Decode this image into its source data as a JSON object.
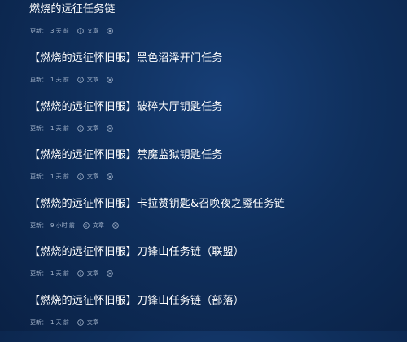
{
  "articles": [
    {
      "title": "燃烧的远征任务链",
      "updated_label": "更新：",
      "time": "3 天 前",
      "type": "文章"
    },
    {
      "title": "【燃烧的远征怀旧服】黑色沼泽开门任务",
      "updated_label": "更新：",
      "time": "1 天 前",
      "type": "文章"
    },
    {
      "title": "【燃烧的远征怀旧服】破碎大厅钥匙任务",
      "updated_label": "更新：",
      "time": "1 天 前",
      "type": "文章"
    },
    {
      "title": "【燃烧的远征怀旧服】禁魔监狱钥匙任务",
      "updated_label": "更新：",
      "time": "1 天 前",
      "type": "文章"
    },
    {
      "title": "【燃烧的远征怀旧服】卡拉赞钥匙&召唤夜之魇任务链",
      "updated_label": "更新：",
      "time": "9 小时 前",
      "type": "文章"
    },
    {
      "title": "【燃烧的远征怀旧服】刀锋山任务链（联盟）",
      "updated_label": "更新：",
      "time": "1 天 前",
      "type": "文章"
    },
    {
      "title": "【燃烧的远征怀旧服】刀锋山任务链（部落）",
      "updated_label": "更新：",
      "time": "1 天 前",
      "type": "文章"
    }
  ],
  "icons": {
    "info": "info-circle-icon",
    "close": "close-circle-icon"
  },
  "colors": {
    "background": "#0f2f5c",
    "title": "#ffffff",
    "meta": "#a9b9cf"
  }
}
